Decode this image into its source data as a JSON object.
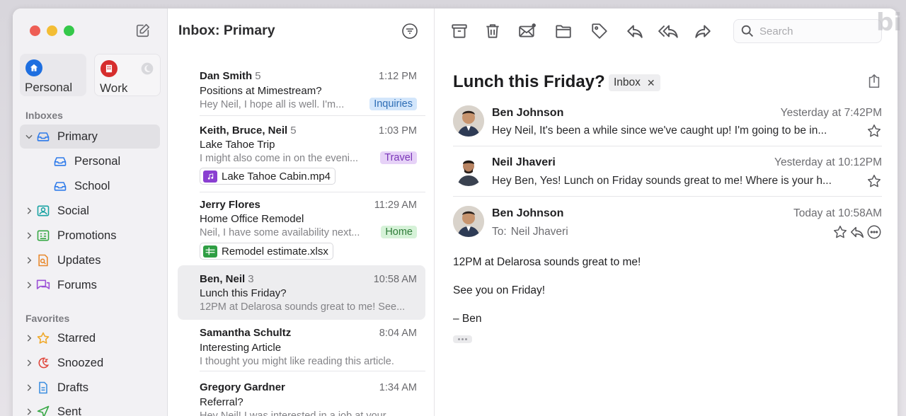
{
  "sidebar": {
    "accounts": [
      {
        "label": "Personal",
        "icon": "home-icon",
        "color": "#1e6fe0"
      },
      {
        "label": "Work",
        "icon": "building-icon",
        "color": "#d62d2d"
      }
    ],
    "inboxes_label": "Inboxes",
    "primary": "Primary",
    "personal": "Personal",
    "school": "School",
    "social": "Social",
    "promotions": "Promotions",
    "updates": "Updates",
    "forums": "Forums",
    "favorites_label": "Favorites",
    "starred": "Starred",
    "snoozed": "Snoozed",
    "drafts": "Drafts",
    "sent": "Sent"
  },
  "list": {
    "title": "Inbox: Primary",
    "messages": [
      {
        "from": "Dan Smith",
        "count": "5",
        "time": "1:12 PM",
        "subject": "Positions at Mimestream?",
        "preview": "Hey Neil, I hope all is well. I'm...",
        "tag": "Inquiries",
        "tag_bg": "#d3e6fb",
        "tag_fg": "#2d6db5"
      },
      {
        "from": "Keith, Bruce, Neil",
        "count": "5",
        "time": "1:03 PM",
        "subject": "Lake Tahoe Trip",
        "preview": "I might also come in on the eveni...",
        "tag": "Travel",
        "tag_bg": "#e6d2f7",
        "tag_fg": "#7a36b8",
        "attachment": "Lake Tahoe Cabin.mp4"
      },
      {
        "from": "Jerry Flores",
        "count": "",
        "time": "11:29 AM",
        "subject": "Home Office Remodel",
        "preview": "Neil, I have some availability next...",
        "tag": "Home",
        "tag_bg": "#d6f2d8",
        "tag_fg": "#2f7d39",
        "attachment": "Remodel estimate.xlsx"
      },
      {
        "from": "Ben, Neil",
        "count": "3",
        "time": "10:58 AM",
        "subject": "Lunch this Friday?",
        "preview": "12PM at Delarosa sounds great to me! See..."
      },
      {
        "from": "Samantha Schultz",
        "count": "",
        "time": "8:04 AM",
        "subject": "Interesting Article",
        "preview": "I thought you might like reading this article."
      },
      {
        "from": "Gregory Gardner",
        "count": "",
        "time": "1:34 AM",
        "subject": "Referral?",
        "preview": "Hey Neil! I was interested in a job at your..."
      }
    ]
  },
  "reader": {
    "search_placeholder": "Search",
    "subject": "Lunch this Friday?",
    "label_chip": "Inbox",
    "thread": [
      {
        "from": "Ben Johnson",
        "time": "Yesterday at 7:42PM",
        "preview": "Hey Neil, It's been a while since we've caught up! I'm going to be in..."
      },
      {
        "from": "Neil Jhaveri",
        "time": "Yesterday at 10:12PM",
        "preview": "Hey Ben, Yes! Lunch on Friday sounds great to me! Where is your h..."
      },
      {
        "from": "Ben Johnson",
        "time": "Today at 10:58AM",
        "to_label": "To:",
        "to": "Neil Jhaveri"
      }
    ],
    "body": [
      "12PM at Delarosa sounds great to me!",
      "See you on Friday!",
      "– Ben"
    ]
  },
  "watermark": "bi"
}
